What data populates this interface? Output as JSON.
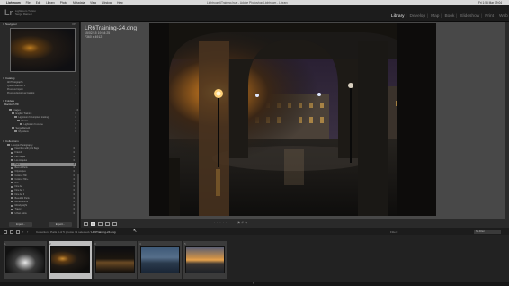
{
  "menubar": {
    "apple_icon": "apple-icon",
    "app_name": "Lightroom",
    "items": [
      "File",
      "Edit",
      "Library",
      "Photo",
      "Metadata",
      "View",
      "Window",
      "Help"
    ],
    "window_title": "Lightroom6Training.lrcat - Adobe Photoshop Lightroom - Library",
    "clock": "Fri 1:55 Mar 19:04"
  },
  "identity": {
    "logo": "Lr",
    "line1": "Lightroom Tuition",
    "line2": "Serge Ramelli"
  },
  "modules": {
    "items": [
      "Library",
      "Develop",
      "Map",
      "Book",
      "Slideshow",
      "Print",
      "Web"
    ],
    "active_index": 0
  },
  "left_panel": {
    "navigator": {
      "title": "Navigator",
      "zoom": "FIT"
    },
    "catalog": {
      "title": "Catalog",
      "items": [
        {
          "label": "All Photographs",
          "count": "1"
        },
        {
          "label": "Quick Collection +",
          "count": "0"
        },
        {
          "label": "Previous Import",
          "count": "1"
        },
        {
          "label": "Previous Export as Catalog",
          "count": "1"
        }
      ]
    },
    "folders": {
      "title": "Folders",
      "volume": "Macintosh HD",
      "items": [
        {
          "label": "Images",
          "count": "6"
        },
        {
          "label": "English Training",
          "count": "6"
        },
        {
          "label": "Lightroom 6 Complete training",
          "count": "6"
        },
        {
          "label": "Photos",
          "count": "6"
        },
        {
          "label": "Lightroom 6 course",
          "count": "6"
        },
        {
          "label": "Serge Ramelli",
          "count": "0"
        },
        {
          "label": "My videos",
          "count": "0"
        }
      ]
    },
    "collections": {
      "title": "Collections",
      "items": [
        {
          "label": "Lifestyle Photography",
          "count": ""
        },
        {
          "label": "Favorites with pick flags",
          "count": "0"
        },
        {
          "label": "Friends",
          "count": "0"
        },
        {
          "label": "Las Vegas",
          "count": "0"
        },
        {
          "label": "Los Angeles",
          "count": "0"
        },
        {
          "label": "Paris",
          "count": "3"
        },
        {
          "label": "Best of Paris",
          "count": "0"
        },
        {
          "label": "Cityscapes",
          "count": "0"
        },
        {
          "label": "Colored Hdr",
          "count": "0"
        },
        {
          "label": "Colored Hdr+",
          "count": "0"
        },
        {
          "label": "Hdr",
          "count": "0"
        },
        {
          "label": "Fine Art",
          "count": "0"
        },
        {
          "label": "Fine Art I",
          "count": "0"
        },
        {
          "label": "Fine Art II",
          "count": "0"
        },
        {
          "label": "Beautiful Paris",
          "count": "0"
        },
        {
          "label": "Monochrome",
          "count": "0"
        },
        {
          "label": "Moody Light",
          "count": "0"
        },
        {
          "label": "Travel",
          "count": "0"
        },
        {
          "label": "Urban Glow",
          "count": "0"
        }
      ],
      "selected_index": 5
    },
    "import_label": "Import...",
    "export_label": "Export..."
  },
  "loupe": {
    "filename": "LR6Training-24.dng",
    "date": "15/02/15 19:54:25",
    "dimensions": "7360 x 4912"
  },
  "toolbar": {
    "stars": "· · · · ·",
    "flags": "⚑ ↶ ↷"
  },
  "filmstrip_bar": {
    "path_prefix": "Collection : Paris",
    "path_detail": "5 of 5 photos / 1 selected /",
    "path_file": "LR6Training-24.dng",
    "filter_label": "Filter :",
    "filter_value": "No Filter"
  },
  "filmstrip": {
    "thumbs": [
      {
        "num": "1",
        "kind": "archway-bw",
        "selected": false
      },
      {
        "num": "2",
        "kind": "arcade-night",
        "selected": true
      },
      {
        "num": "3",
        "kind": "night-facade",
        "selected": false
      },
      {
        "num": "4",
        "kind": "blue-bridge",
        "selected": false
      },
      {
        "num": "5",
        "kind": "sunset-river",
        "selected": false
      }
    ]
  },
  "colors": {
    "accent_active": "#e8e8e8",
    "panel": "#292929",
    "background": "#484848",
    "lamp_glow": "#f2b23c"
  }
}
